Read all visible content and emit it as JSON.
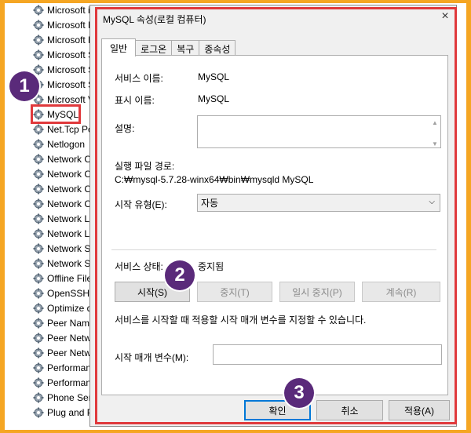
{
  "services": [
    {
      "label": "Microsoft i"
    },
    {
      "label": "Microsoft P"
    },
    {
      "label": "Microsoft P"
    },
    {
      "label": "Microsoft S"
    },
    {
      "label": "Microsoft S"
    },
    {
      "label": "Microsoft S"
    },
    {
      "label": "Microsoft V"
    },
    {
      "label": "MySQL"
    },
    {
      "label": "Net.Tcp Po"
    },
    {
      "label": "Netlogon"
    },
    {
      "label": "Network C"
    },
    {
      "label": "Network C"
    },
    {
      "label": "Network C"
    },
    {
      "label": "Network C"
    },
    {
      "label": "Network Li"
    },
    {
      "label": "Network Lo"
    },
    {
      "label": "Network Se"
    },
    {
      "label": "Network St"
    },
    {
      "label": "Offline File"
    },
    {
      "label": "OpenSSH A"
    },
    {
      "label": "Optimize d"
    },
    {
      "label": "Peer Name"
    },
    {
      "label": "Peer Netwo"
    },
    {
      "label": "Peer Netwo"
    },
    {
      "label": "Performanc"
    },
    {
      "label": "Performanc"
    },
    {
      "label": "Phone Serv"
    },
    {
      "label": "Plug and P"
    }
  ],
  "badges": {
    "one": "1",
    "two": "2",
    "three": "3"
  },
  "dialog": {
    "title": "MySQL 속성(로컬 컴퓨터)",
    "close": "×",
    "tabs": [
      "일반",
      "로그온",
      "복구",
      "종속성"
    ],
    "service_name_label": "서비스 이름:",
    "service_name": "MySQL",
    "display_name_label": "표시 이름:",
    "display_name": "MySQL",
    "description_label": "설명:",
    "exe_path_label": "실행 파일 경로:",
    "exe_path": "C:₩mysql-5.7.28-winx64₩bin₩mysqld MySQL",
    "startup_type_label": "시작 유형(E):",
    "startup_type": "자동",
    "status_label": "서비스 상태:",
    "status": "중지됨",
    "buttons": {
      "start": "시작(S)",
      "stop": "중지(T)",
      "pause": "일시 중지(P)",
      "resume": "계속(R)"
    },
    "hint": "서비스를 시작할 때 적용할 시작 매개 변수를 지정할 수 있습니다.",
    "param_label": "시작 매개 변수(M):",
    "param_value": "",
    "footer": {
      "ok": "확인",
      "cancel": "취소",
      "apply": "적용(A)"
    }
  }
}
